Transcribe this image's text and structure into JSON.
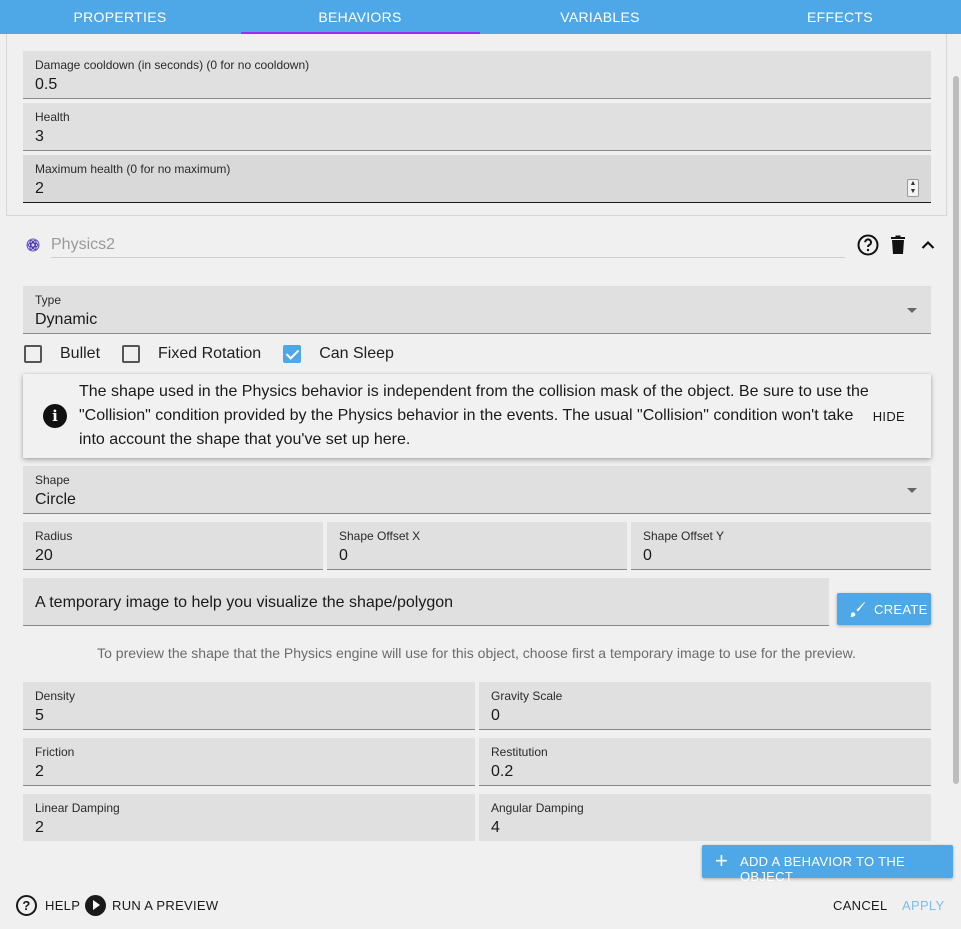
{
  "tabs": [
    {
      "label": "PROPERTIES"
    },
    {
      "label": "BEHAVIORS",
      "active": true
    },
    {
      "label": "VARIABLES"
    },
    {
      "label": "EFFECTS"
    }
  ],
  "health_behavior": {
    "damage_cooldown": {
      "label": "Damage cooldown (in seconds) (0 for no cooldown)",
      "value": "0.5"
    },
    "health": {
      "label": "Health",
      "value": "3"
    },
    "max_health": {
      "label": "Maximum health (0 for no maximum)",
      "value": "2"
    }
  },
  "physics": {
    "name_placeholder": "Physics2",
    "type": {
      "label": "Type",
      "value": "Dynamic"
    },
    "checkboxes": [
      {
        "label": "Bullet",
        "checked": false
      },
      {
        "label": "Fixed Rotation",
        "checked": false
      },
      {
        "label": "Can Sleep",
        "checked": true
      }
    ],
    "info": {
      "text": "The shape used in the Physics behavior is independent from the collision mask of the object. Be sure to use the \"Collision\" condition provided by the Physics behavior in the events. The usual \"Collision\" condition won't take into account the shape that you've set up here.",
      "hide_label": "HIDE"
    },
    "shape": {
      "label": "Shape",
      "value": "Circle"
    },
    "radius": {
      "label": "Radius",
      "value": "20"
    },
    "offset_x": {
      "label": "Shape Offset X",
      "value": "0"
    },
    "offset_y": {
      "label": "Shape Offset Y",
      "value": "0"
    },
    "temp_image": {
      "placeholder": "A temporary image to help you visualize the shape/polygon"
    },
    "create_label": "CREATE",
    "hint": "To preview the shape that the Physics engine will use for this object, choose first a temporary image to use for the preview.",
    "density": {
      "label": "Density",
      "value": "5"
    },
    "gravity_scale": {
      "label": "Gravity Scale",
      "value": "0"
    },
    "friction": {
      "label": "Friction",
      "value": "2"
    },
    "restitution": {
      "label": "Restitution",
      "value": "0.2"
    },
    "linear_damping": {
      "label": "Linear Damping",
      "value": "2"
    },
    "angular_damping": {
      "label": "Angular Damping",
      "value": "4"
    }
  },
  "actions": {
    "add_behavior": "ADD A BEHAVIOR TO THE OBJECT",
    "help": "HELP",
    "run_preview": "RUN A PREVIEW",
    "cancel": "CANCEL",
    "apply": "APPLY"
  },
  "colors": {
    "accent": "#4ea7e6",
    "tab_indicator": "#9b2cf0",
    "apply_disabled": "#7fbde9"
  },
  "icons": [
    "help-circle-icon",
    "trash-icon",
    "chevron-up-icon",
    "info-icon",
    "brush-icon",
    "plus-icon",
    "play-circle-icon",
    "physics-behavior-icon"
  ]
}
